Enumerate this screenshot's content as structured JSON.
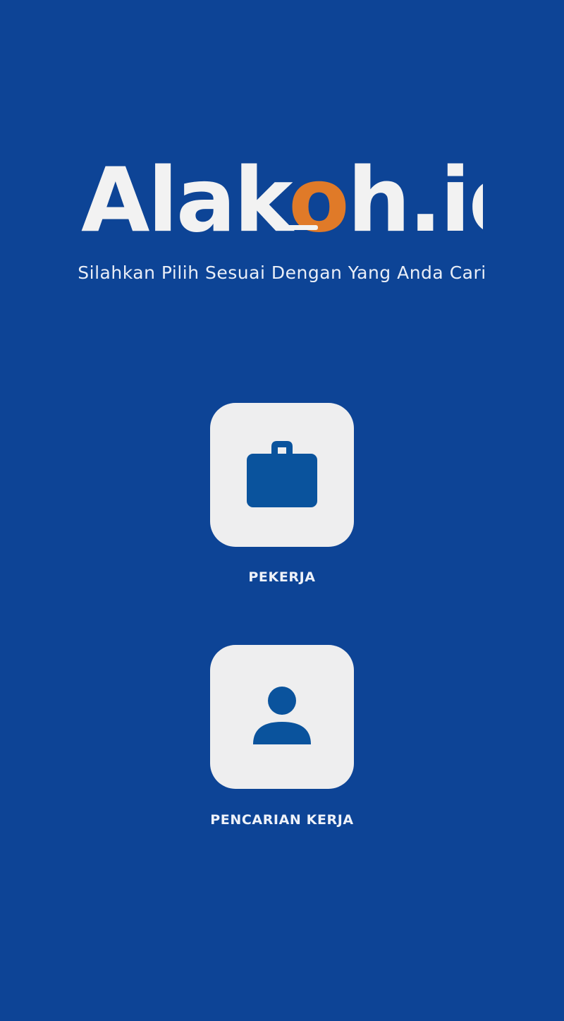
{
  "brand": {
    "name_part1": "Alak",
    "name_highlight": "o",
    "name_part2": "h.id",
    "primary_color": "#0D4496",
    "accent_color": "#E07A28",
    "text_color": "#F2F2F2"
  },
  "subtitle": "Silahkan Pilih Sesuai Dengan Yang Anda Cari",
  "options": [
    {
      "label": "PEKERJA",
      "icon": "briefcase-icon"
    },
    {
      "label": "PENCARIAN KERJA",
      "icon": "person-icon"
    }
  ],
  "card": {
    "background": "#EEEEEF",
    "icon_color": "#0A539D"
  }
}
